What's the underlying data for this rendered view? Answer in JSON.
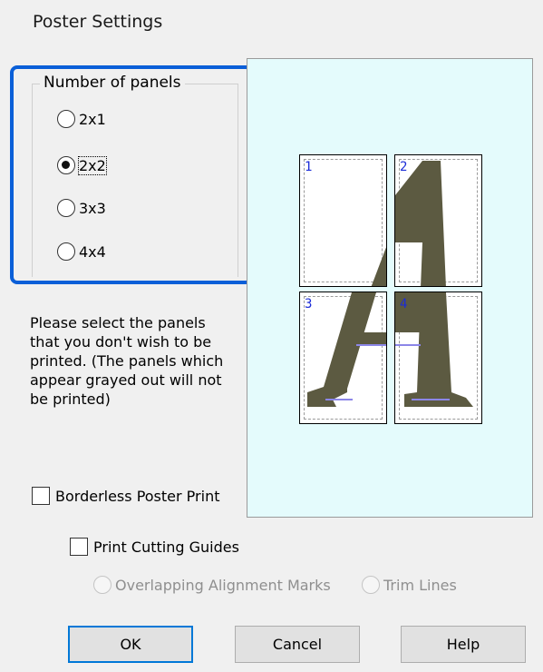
{
  "dialog": {
    "title": "Poster Settings"
  },
  "panels": {
    "group_label": "Number of panels",
    "options": [
      {
        "label": "2x1",
        "checked": false
      },
      {
        "label": "2x2",
        "checked": true
      },
      {
        "label": "3x3",
        "checked": false
      },
      {
        "label": "4x4",
        "checked": false
      }
    ]
  },
  "instructions": "Please select the panels that you don't wish to be printed. (The panels which appear grayed out will not be printed)",
  "preview": {
    "tiles": [
      "1",
      "2",
      "3",
      "4"
    ],
    "colors": {
      "background": "#e4fbfc",
      "letter": "#5c5a41",
      "number": "#1b2cd8"
    }
  },
  "borderless": {
    "label": "Borderless Poster Print",
    "checked": false
  },
  "cutting_guides": {
    "label": "Print Cutting Guides",
    "checked": false
  },
  "guide_options": [
    {
      "label": "Overlapping Alignment Marks",
      "enabled": false
    },
    {
      "label": "Trim Lines",
      "enabled": false
    }
  ],
  "buttons": {
    "ok": "OK",
    "cancel": "Cancel",
    "help": "Help"
  },
  "colors": {
    "highlight": "#0a5fd8",
    "accent": "#0078d7"
  }
}
